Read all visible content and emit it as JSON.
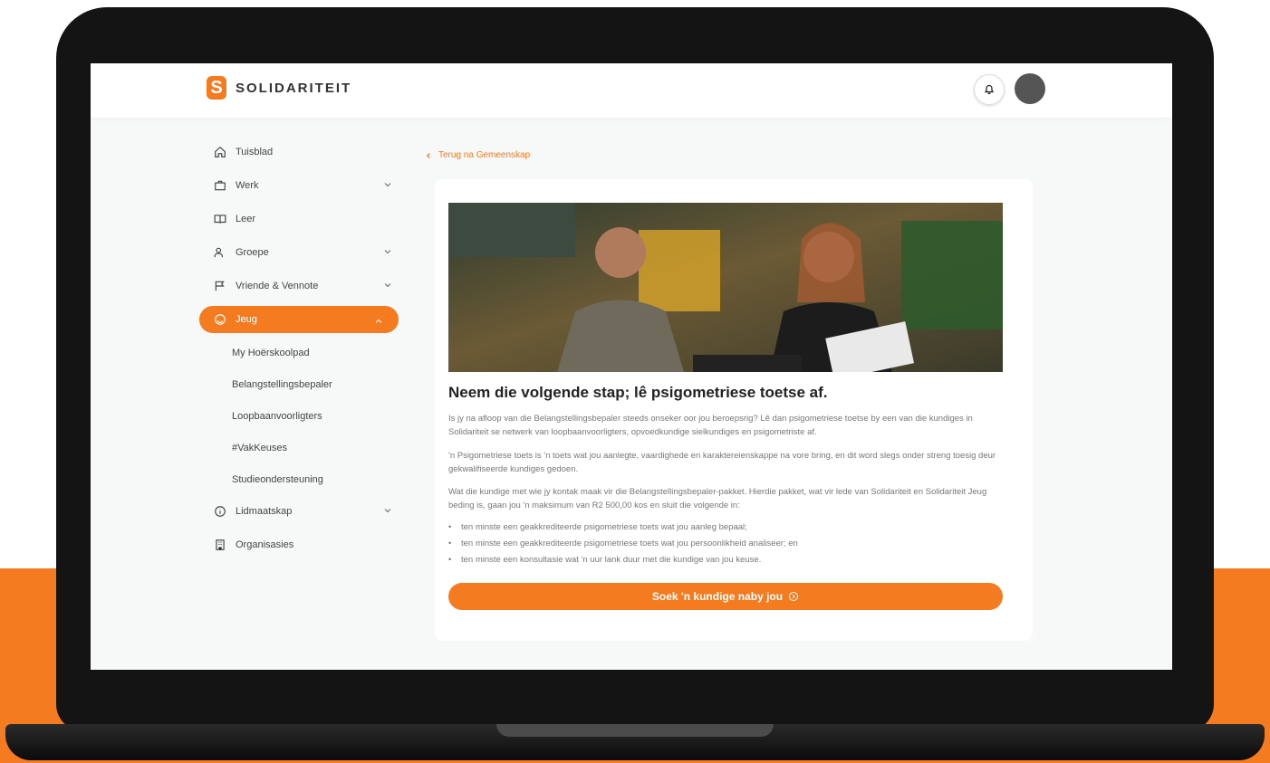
{
  "brand": {
    "name": "SOLIDARITEIT",
    "accent": "#f47b20"
  },
  "header": {
    "bell_icon": "bell-icon",
    "avatar": "user-avatar"
  },
  "sidebar": {
    "items": [
      {
        "label": "Tuisblad",
        "icon": "home-icon"
      },
      {
        "label": "Werk",
        "icon": "briefcase-icon",
        "expandable": true
      },
      {
        "label": "Leer",
        "icon": "book-icon"
      },
      {
        "label": "Groepe",
        "icon": "group-icon",
        "expandable": true
      },
      {
        "label": "Vriende & Vennote",
        "icon": "flag-icon",
        "expandable": true
      },
      {
        "label": "Jeug",
        "icon": "smiley-icon",
        "expandable": true,
        "active": true
      },
      {
        "label": "Lidmaatskap",
        "icon": "info-icon",
        "expandable": true
      },
      {
        "label": "Organisasies",
        "icon": "building-icon"
      }
    ],
    "jeug_sub": [
      "My Hoërskoolpad",
      "Belangstellingsbepaler",
      "Loopbaanvoorligters",
      "#VakKeuses",
      "Studieondersteuning"
    ]
  },
  "content": {
    "back_link": "Terug na Gemeenskap",
    "title": "Neem die volgende stap; lê psigometriese toetse af.",
    "paragraphs": [
      "Is jy na afloop van die Belangstellingsbepaler steeds onseker oor jou beroepsrig? Lê dan psigometriese toetse by een van die kundiges in Solidariteit se netwerk van loopbaanvoorligters, opvoedkundige sielkundiges en psigometriste af.",
      "'n Psigometriese toets is 'n toets wat jou aanlegte, vaardighede en karaktereienskappe na vore bring, en dit word slegs onder streng toesig deur gekwalifiseerde kundiges gedoen.",
      "Wat die kundige met wie jy kontak maak vir die Belangstellingsbepaler-pakket. Hierdie pakket, wat vir lede van Solidariteit en Solidariteit Jeug beding is, gaan jou 'n maksimum van R2 500,00 kos en sluit die volgende in:"
    ],
    "bullets": [
      "ten minste een geakkrediteerde psigometriese toets wat jou aanleg bepaal;",
      "ten minste een geakkrediteerde psigometriese toets wat jou persoonlikheid analiseer; en",
      "ten minste een konsultasie wat 'n uur lank duur met die kundige van jou keuse."
    ],
    "cta_label": "Soek 'n kundige naby jou",
    "cta_icon": "arrow-circle-icon"
  }
}
